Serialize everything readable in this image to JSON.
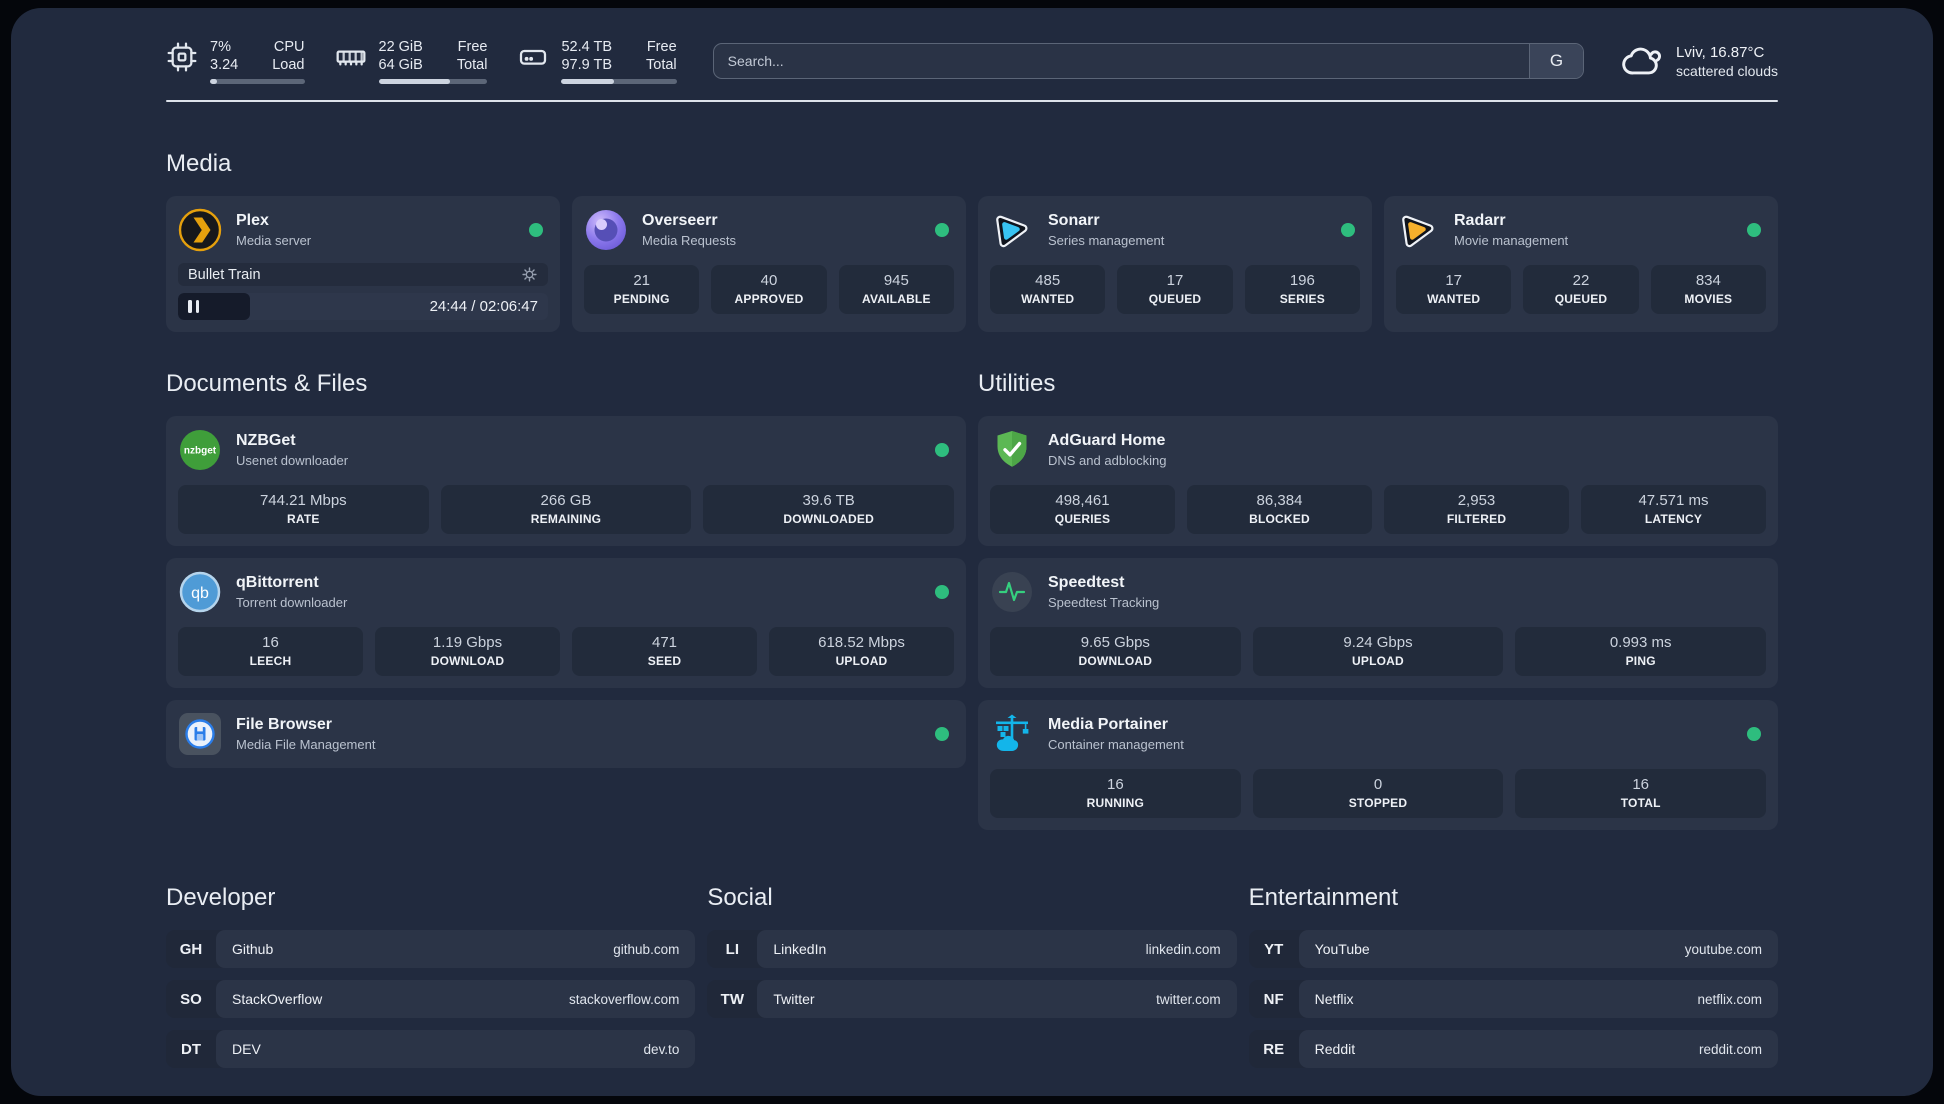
{
  "topbar": {
    "stats": [
      {
        "name": "cpu",
        "value_top": "7%",
        "value_bottom": "3.24",
        "label_top": "CPU",
        "label_bottom": "Load",
        "progress_pct": 7
      },
      {
        "name": "memory",
        "value_top": "22 GiB",
        "value_bottom": "64 GiB",
        "label_top": "Free",
        "label_bottom": "Total",
        "progress_pct": 66
      },
      {
        "name": "storage",
        "value_top": "52.4 TB",
        "value_bottom": "97.9 TB",
        "label_top": "Free",
        "label_bottom": "Total",
        "progress_pct": 46
      }
    ],
    "search": {
      "placeholder": "Search...",
      "engine_button": "G"
    },
    "weather": {
      "location_temp": "Lviv, 16.87°C",
      "condition": "scattered clouds"
    }
  },
  "media": {
    "title": "Media",
    "plex": {
      "name": "Plex",
      "subtitle": "Media server",
      "status": "online",
      "player": {
        "track": "Bullet Train",
        "time": "24:44 / 02:06:47",
        "progress_pct": 19.5,
        "state": "paused"
      }
    },
    "overseerr": {
      "name": "Overseerr",
      "subtitle": "Media Requests",
      "status": "online",
      "stats": [
        {
          "value": "21",
          "label": "PENDING"
        },
        {
          "value": "40",
          "label": "APPROVED"
        },
        {
          "value": "945",
          "label": "AVAILABLE"
        }
      ]
    },
    "sonarr": {
      "name": "Sonarr",
      "subtitle": "Series management",
      "status": "online",
      "stats": [
        {
          "value": "485",
          "label": "WANTED"
        },
        {
          "value": "17",
          "label": "QUEUED"
        },
        {
          "value": "196",
          "label": "SERIES"
        }
      ]
    },
    "radarr": {
      "name": "Radarr",
      "subtitle": "Movie management",
      "status": "online",
      "stats": [
        {
          "value": "17",
          "label": "WANTED"
        },
        {
          "value": "22",
          "label": "QUEUED"
        },
        {
          "value": "834",
          "label": "MOVIES"
        }
      ]
    }
  },
  "documents": {
    "title": "Documents & Files",
    "nzbget": {
      "name": "NZBGet",
      "subtitle": "Usenet downloader",
      "status": "online",
      "stats": [
        {
          "value": "744.21 Mbps",
          "label": "RATE"
        },
        {
          "value": "266 GB",
          "label": "REMAINING"
        },
        {
          "value": "39.6 TB",
          "label": "DOWNLOADED"
        }
      ]
    },
    "qbittorrent": {
      "name": "qBittorrent",
      "subtitle": "Torrent downloader",
      "status": "online",
      "stats": [
        {
          "value": "16",
          "label": "LEECH"
        },
        {
          "value": "1.19 Gbps",
          "label": "DOWNLOAD"
        },
        {
          "value": "471",
          "label": "SEED"
        },
        {
          "value": "618.52 Mbps",
          "label": "UPLOAD"
        }
      ]
    },
    "filebrowser": {
      "name": "File Browser",
      "subtitle": "Media File Management",
      "status": "online"
    }
  },
  "utilities": {
    "title": "Utilities",
    "adguard": {
      "name": "AdGuard Home",
      "subtitle": "DNS and adblocking",
      "stats": [
        {
          "value": "498,461",
          "label": "QUERIES"
        },
        {
          "value": "86,384",
          "label": "BLOCKED"
        },
        {
          "value": "2,953",
          "label": "FILTERED"
        },
        {
          "value": "47.571 ms",
          "label": "LATENCY"
        }
      ]
    },
    "speedtest": {
      "name": "Speedtest",
      "subtitle": "Speedtest Tracking",
      "stats": [
        {
          "value": "9.65 Gbps",
          "label": "DOWNLOAD"
        },
        {
          "value": "9.24 Gbps",
          "label": "UPLOAD"
        },
        {
          "value": "0.993 ms",
          "label": "PING"
        }
      ]
    },
    "portainer": {
      "name": "Media Portainer",
      "subtitle": "Container management",
      "status": "online",
      "stats": [
        {
          "value": "16",
          "label": "RUNNING"
        },
        {
          "value": "0",
          "label": "STOPPED"
        },
        {
          "value": "16",
          "label": "TOTAL"
        }
      ]
    }
  },
  "links": {
    "developer": {
      "title": "Developer",
      "items": [
        {
          "abbr": "GH",
          "name": "Github",
          "url": "github.com"
        },
        {
          "abbr": "SO",
          "name": "StackOverflow",
          "url": "stackoverflow.com"
        },
        {
          "abbr": "DT",
          "name": "DEV",
          "url": "dev.to"
        }
      ]
    },
    "social": {
      "title": "Social",
      "items": [
        {
          "abbr": "LI",
          "name": "LinkedIn",
          "url": "linkedin.com"
        },
        {
          "abbr": "TW",
          "name": "Twitter",
          "url": "twitter.com"
        }
      ]
    },
    "entertainment": {
      "title": "Entertainment",
      "items": [
        {
          "abbr": "YT",
          "name": "YouTube",
          "url": "youtube.com"
        },
        {
          "abbr": "NF",
          "name": "Netflix",
          "url": "netflix.com"
        },
        {
          "abbr": "RE",
          "name": "Reddit",
          "url": "reddit.com"
        }
      ]
    }
  },
  "colors": {
    "status_online": "#2ebd7e",
    "plex_amber": "#e5a00d",
    "sonarr_blue": "#38c3f1",
    "radarr_amber": "#f6b02c",
    "nzbget_green": "#3f9e3a",
    "qbittorrent_blue": "#4f9bd6",
    "adguard_green": "#5cb854",
    "speedtest_green": "#35d07f",
    "portainer_blue": "#13b5ea",
    "overseerr_purple": "#8b78ec"
  }
}
